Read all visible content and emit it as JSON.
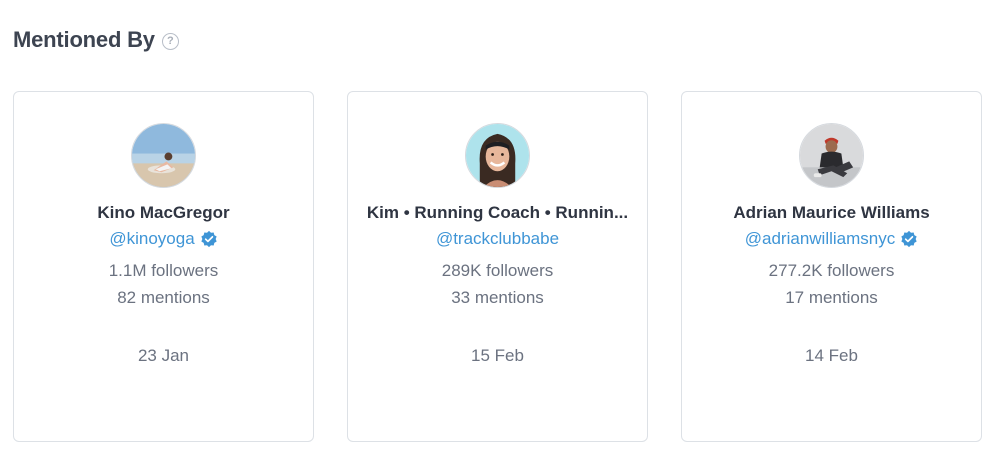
{
  "header": {
    "title": "Mentioned By",
    "help_icon": "question-circle-icon"
  },
  "cards": [
    {
      "name": "Kino MacGregor",
      "handle": "@kinoyoga",
      "verified": true,
      "followers": "1.1M followers",
      "mentions": "82 mentions",
      "date": "23 Jan"
    },
    {
      "name": "Kim • Running Coach • Runnin...",
      "handle": "@trackclubbabe",
      "verified": false,
      "followers": "289K followers",
      "mentions": "33 mentions",
      "date": "15 Feb"
    },
    {
      "name": "Adrian Maurice Williams",
      "handle": "@adrianwilliamsnyc",
      "verified": true,
      "followers": "277.2K followers",
      "mentions": "17 mentions",
      "date": "14 Feb"
    }
  ],
  "colors": {
    "link": "#3f95d6",
    "verified": "#3f95d6",
    "title": "#3d4451",
    "muted": "#6b7280",
    "border": "#dde1e6"
  }
}
